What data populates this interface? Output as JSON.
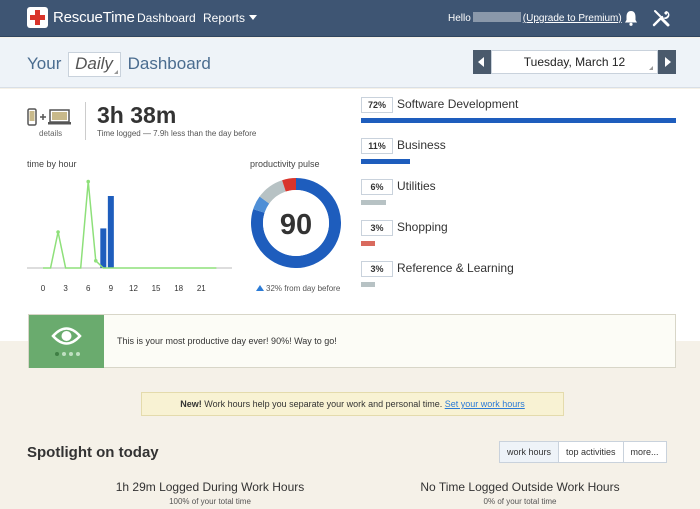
{
  "nav": {
    "logo_text": "RescueTime",
    "dashboard": "Dashboard",
    "reports": "Reports",
    "hello": "Hello",
    "upgrade": "(Upgrade to Premium)"
  },
  "header": {
    "your": "Your",
    "daily": "Daily",
    "dashboard": "Dashboard",
    "date": "Tuesday, March 12"
  },
  "summary": {
    "details": "details",
    "total": "3h 38m",
    "subtitle": "Time logged — 7.9h less than the day before"
  },
  "time_by_hour": {
    "label": "time by hour"
  },
  "pulse": {
    "label": "productivity pulse",
    "score": "90",
    "change": "32% from day before",
    "segments": [
      {
        "value": 0.8,
        "color": "#1e5dbd"
      },
      {
        "value": 0.05,
        "color": "#4f8fd6"
      },
      {
        "value": 0.1,
        "color": "#b7c2c4"
      },
      {
        "value": 0.05,
        "color": "#d9342b"
      }
    ]
  },
  "categories": [
    {
      "pct": "72%",
      "name": "Software Development",
      "fraction": 1.0,
      "color": "#1e5dbd"
    },
    {
      "pct": "11%",
      "name": "Business",
      "fraction": 0.155,
      "color": "#1e5dbd"
    },
    {
      "pct": "6%",
      "name": "Utilities",
      "fraction": 0.08,
      "color": "#b7c2c4"
    },
    {
      "pct": "3%",
      "name": "Shopping",
      "fraction": 0.045,
      "color": "#d96a5e"
    },
    {
      "pct": "3%",
      "name": "Reference & Learning",
      "fraction": 0.045,
      "color": "#b7c2c4"
    }
  ],
  "banner": {
    "text": "This is your most productive day ever! 90%! Way to go!"
  },
  "notice": {
    "new": "New!",
    "text": " Work hours help you separate your work and personal time. ",
    "link": "Set your work hours"
  },
  "spotlight": {
    "title": "Spotlight on today",
    "tabs": [
      "work hours",
      "top activities",
      "more..."
    ],
    "left_big": "1h 29m Logged During Work Hours",
    "left_small": "100% of your total time",
    "right_big": "No Time Logged Outside Work Hours",
    "right_small": "0% of your total time"
  },
  "chart_data": {
    "type": "bar",
    "x_ticks": [
      "0",
      "3",
      "6",
      "9",
      "12",
      "15",
      "18",
      "21"
    ],
    "x": [
      0,
      1,
      2,
      3,
      4,
      5,
      6,
      7,
      8,
      9,
      10,
      11,
      12,
      13,
      14,
      15,
      16,
      17,
      18,
      19,
      20,
      21,
      22,
      23
    ],
    "series": [
      {
        "type": "bar",
        "color": "#1e5dbd",
        "values": [
          0,
          0,
          0,
          0,
          0,
          0,
          0,
          0,
          0.55,
          1.0,
          0,
          0,
          0,
          0,
          0,
          0,
          0,
          0,
          0,
          0,
          0,
          0,
          0,
          0
        ]
      },
      {
        "type": "line",
        "color": "#8ee07a",
        "values": [
          0,
          0,
          0.5,
          0,
          0,
          0,
          1.2,
          0.1,
          0,
          0,
          0,
          0,
          0,
          0,
          0,
          0,
          0,
          0,
          0,
          0,
          0,
          0,
          0,
          0
        ]
      }
    ]
  }
}
